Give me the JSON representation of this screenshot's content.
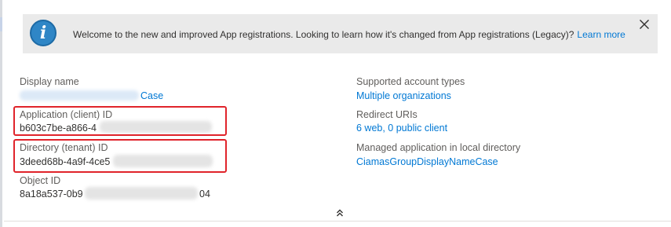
{
  "banner": {
    "text": "Welcome to the new and improved App registrations. Looking to learn how it's changed from App registrations (Legacy)?",
    "link_label": "Learn more",
    "info_icon_glyph": "i",
    "icon_name": "info-icon",
    "close_icon_name": "close-icon"
  },
  "essentials": {
    "left": {
      "display_name": {
        "label": "Display name",
        "value_suffix": "Case"
      },
      "application_id": {
        "label": "Application (client) ID",
        "value": "b603c7be-a866-4"
      },
      "directory_id": {
        "label": "Directory (tenant) ID",
        "value": "3deed68b-4a9f-4ce5"
      },
      "object_id": {
        "label": "Object ID",
        "value_prefix": "8a18a537-0b9",
        "value_suffix": "04"
      }
    },
    "right": {
      "supported_account_types": {
        "label": "Supported account types",
        "value": "Multiple organizations"
      },
      "redirect_uris": {
        "label": "Redirect URIs",
        "value": "6 web, 0 public client"
      },
      "managed_application": {
        "label": "Managed application in local directory",
        "value": "CiamasGroupDisplayNameCase"
      }
    }
  },
  "collapse_icon_name": "chevron-double-up-icon",
  "colors": {
    "link": "#0078d4",
    "highlight": "#e0242b",
    "banner_bg": "#eaeaea",
    "info_icon": "#2f86c6"
  }
}
